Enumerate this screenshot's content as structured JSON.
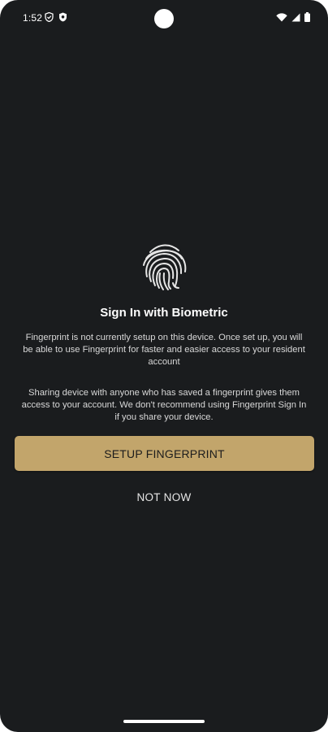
{
  "status_bar": {
    "time": "1:52",
    "left_icons": [
      "vpn-shield-icon",
      "security-shield-icon"
    ],
    "right_icons": [
      "wifi-icon",
      "signal-icon",
      "battery-icon"
    ]
  },
  "screen": {
    "icon": "fingerprint-icon",
    "title": "Sign In with Biometric",
    "message_1": "Fingerprint is not currently setup on this device. Once set up, you will be able to use Fingerprint for faster and easier access to your resident account",
    "message_2": "Sharing device with anyone who has saved a fingerprint gives them access to your account. We don't recommend using Fingerprint Sign In if you share your device.",
    "primary_button": "SETUP FINGERPRINT",
    "secondary_button": "NOT NOW"
  },
  "colors": {
    "background": "#1a1c1e",
    "accent": "#c2a56b",
    "text": "#ffffff"
  }
}
